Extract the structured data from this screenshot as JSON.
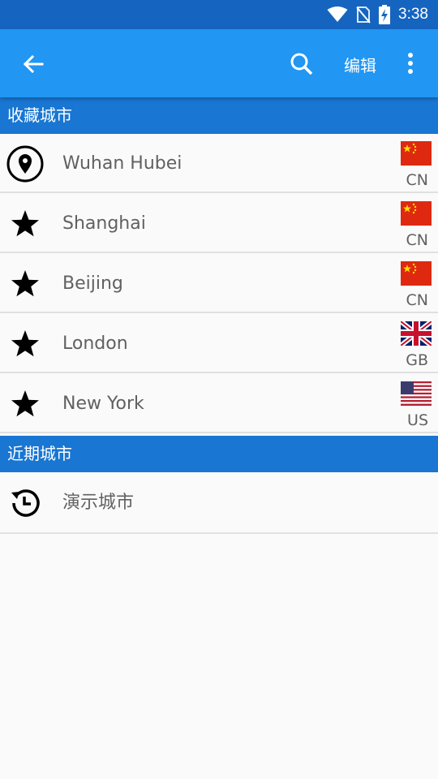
{
  "status_bar": {
    "time": "3:38"
  },
  "app_bar": {
    "edit_label": "编辑"
  },
  "favorites": {
    "header": "收藏城市",
    "items": [
      {
        "city": "Wuhan Hubei",
        "country": "CN",
        "icon": "location-pin-icon",
        "flag": "china-flag-icon"
      },
      {
        "city": "Shanghai",
        "country": "CN",
        "icon": "star-icon",
        "flag": "china-flag-icon"
      },
      {
        "city": "Beijing",
        "country": "CN",
        "icon": "star-icon",
        "flag": "china-flag-icon"
      },
      {
        "city": "London",
        "country": "GB",
        "icon": "star-icon",
        "flag": "uk-flag-icon"
      },
      {
        "city": "New York",
        "country": "US",
        "icon": "star-icon",
        "flag": "us-flag-icon"
      }
    ]
  },
  "recent": {
    "header": "近期城市",
    "items": [
      {
        "city": "演示城市",
        "icon": "history-icon"
      }
    ]
  },
  "colors": {
    "status_bar": "#1565c0",
    "app_bar": "#2196f3",
    "section_header": "#1976d2",
    "text_secondary": "#616161"
  }
}
